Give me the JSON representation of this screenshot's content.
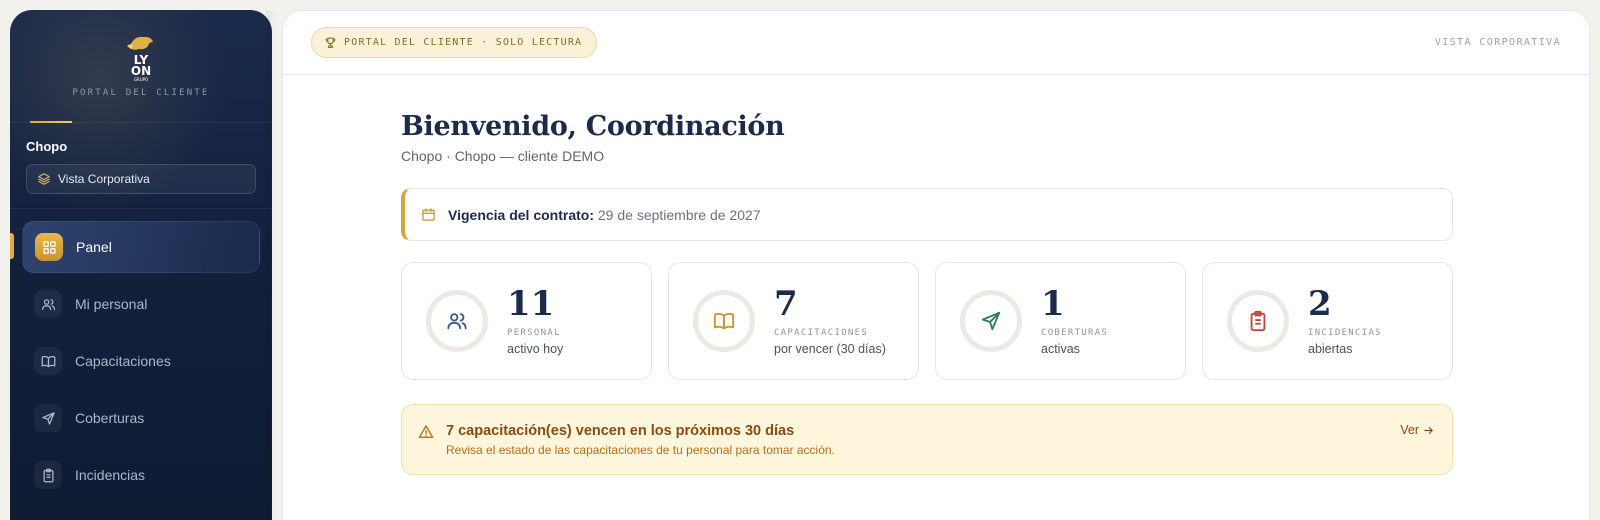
{
  "sidebar": {
    "brand_top": "LY",
    "brand_bottom": "ON",
    "brand_tiny": "GRUPO",
    "brand_subtitle": "PORTAL DEL CLIENTE",
    "client_name": "Chopo",
    "view_selector": {
      "label": "Vista Corporativa",
      "icon": "layers-icon"
    },
    "nav": [
      {
        "label": "Panel",
        "icon": "dashboard-icon",
        "active": true
      },
      {
        "label": "Mi personal",
        "icon": "users-icon",
        "active": false
      },
      {
        "label": "Capacitaciones",
        "icon": "book-icon",
        "active": false
      },
      {
        "label": "Coberturas",
        "icon": "send-icon",
        "active": false
      },
      {
        "label": "Incidencias",
        "icon": "clipboard-icon",
        "active": false
      }
    ]
  },
  "topbar": {
    "badge": "PORTAL DEL CLIENTE · SOLO LECTURA",
    "right_label": "VISTA CORPORATIVA"
  },
  "main": {
    "welcome_title": "Bienvenido, Coordinación",
    "welcome_subtitle": "Chopo · Chopo — cliente DEMO",
    "contract": {
      "label": "Vigencia del contrato:",
      "value": "29 de septiembre de 2027"
    },
    "stats": [
      {
        "value": "11",
        "label": "PERSONAL",
        "desc": "activo hoy",
        "icon": "users-icon",
        "color": "#3d5a8a"
      },
      {
        "value": "7",
        "label": "CAPACITACIONES",
        "desc": "por vencer (30 días)",
        "icon": "book-icon",
        "color": "#c9932e"
      },
      {
        "value": "1",
        "label": "COBERTURAS",
        "desc": "activas",
        "icon": "send-icon",
        "color": "#2f7d5b"
      },
      {
        "value": "2",
        "label": "INCIDENCIAS",
        "desc": "abiertas",
        "icon": "clipboard-icon",
        "color": "#c0463a"
      }
    ],
    "alert": {
      "title": "7 capacitación(es) vencen en los próximos 30 días",
      "description": "Revisa el estado de las capacitaciones de tu personal para tomar acción.",
      "link": "Ver"
    }
  },
  "colors": {
    "sidebar_bg": "#13213d",
    "accent_gold": "#d2a43c",
    "alert_bg": "#fdf6dc",
    "text_navy": "#1d2b4a"
  }
}
